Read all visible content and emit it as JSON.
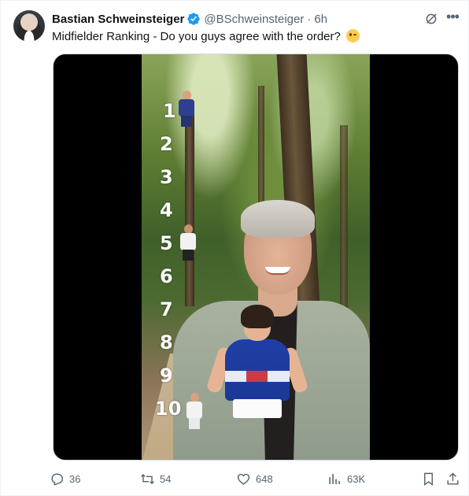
{
  "author": {
    "name": "Bastian Schweinsteiger",
    "handle": "@BSchweinsteiger",
    "separator": "·",
    "time": "6h",
    "verified": true
  },
  "tweet": {
    "text": "Midfielder Ranking - Do you guys agree with the order?",
    "emoji": "winking-face"
  },
  "media": {
    "ranks": [
      "1",
      "2",
      "3",
      "4",
      "5",
      "6",
      "7",
      "8",
      "9",
      "10"
    ]
  },
  "actions": {
    "replies": "36",
    "retweets": "54",
    "likes": "648",
    "views": "63K"
  },
  "colors": {
    "text_primary": "#0f1419",
    "text_secondary": "#536471",
    "verified_blue": "#1d9bf0"
  }
}
